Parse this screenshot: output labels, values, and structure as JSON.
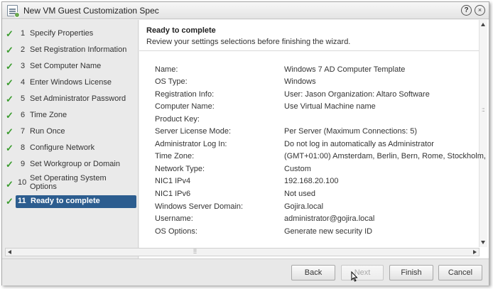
{
  "window": {
    "title": "New VM Guest Customization Spec"
  },
  "steps": [
    {
      "num": "1",
      "label": "Specify Properties"
    },
    {
      "num": "2",
      "label": "Set Registration Information"
    },
    {
      "num": "3",
      "label": "Set Computer Name"
    },
    {
      "num": "4",
      "label": "Enter Windows License"
    },
    {
      "num": "5",
      "label": "Set Administrator Password"
    },
    {
      "num": "6",
      "label": "Time Zone"
    },
    {
      "num": "7",
      "label": "Run Once"
    },
    {
      "num": "8",
      "label": "Configure Network"
    },
    {
      "num": "9",
      "label": "Set Workgroup or Domain"
    },
    {
      "num": "10",
      "label": "Set Operating System Options"
    },
    {
      "num": "11",
      "label": "Ready to complete"
    }
  ],
  "header": {
    "title": "Ready to complete",
    "subtitle": "Review your settings selections before finishing the wizard."
  },
  "summary": [
    {
      "key": "Name:",
      "value": "Windows 7 AD Computer Template"
    },
    {
      "key": "OS Type:",
      "value": "Windows"
    },
    {
      "key": "Registration Info:",
      "value": "User: Jason  Organization: Altaro Software"
    },
    {
      "key": "Computer Name:",
      "value": "Use Virtual Machine name"
    },
    {
      "key": "Product Key:",
      "value": ""
    },
    {
      "key": "Server License Mode:",
      "value": "Per Server (Maximum Connections: 5)"
    },
    {
      "key": "Administrator Log In:",
      "value": "Do not log in automatically as Administrator"
    },
    {
      "key": "Time Zone:",
      "value": "(GMT+01:00) Amsterdam, Berlin, Bern, Rome, Stockholm,"
    },
    {
      "key": "Network Type:",
      "value": "Custom"
    },
    {
      "key": "NIC1 IPv4",
      "value": "192.168.20.100"
    },
    {
      "key": "NIC1 IPv6",
      "value": "Not used"
    },
    {
      "key": "Windows Server Domain:",
      "value": "Gojira.local"
    },
    {
      "key": "Username:",
      "value": "administrator@gojira.local"
    },
    {
      "key": "OS Options:",
      "value": "Generate new security ID"
    }
  ],
  "buttons": {
    "back": "Back",
    "next": "Next",
    "finish": "Finish",
    "cancel": "Cancel"
  },
  "icons": {
    "help": "?",
    "close": "×",
    "check": "✓"
  },
  "colors": {
    "accent": "#2c5d8f",
    "check": "#3a9c2e"
  }
}
